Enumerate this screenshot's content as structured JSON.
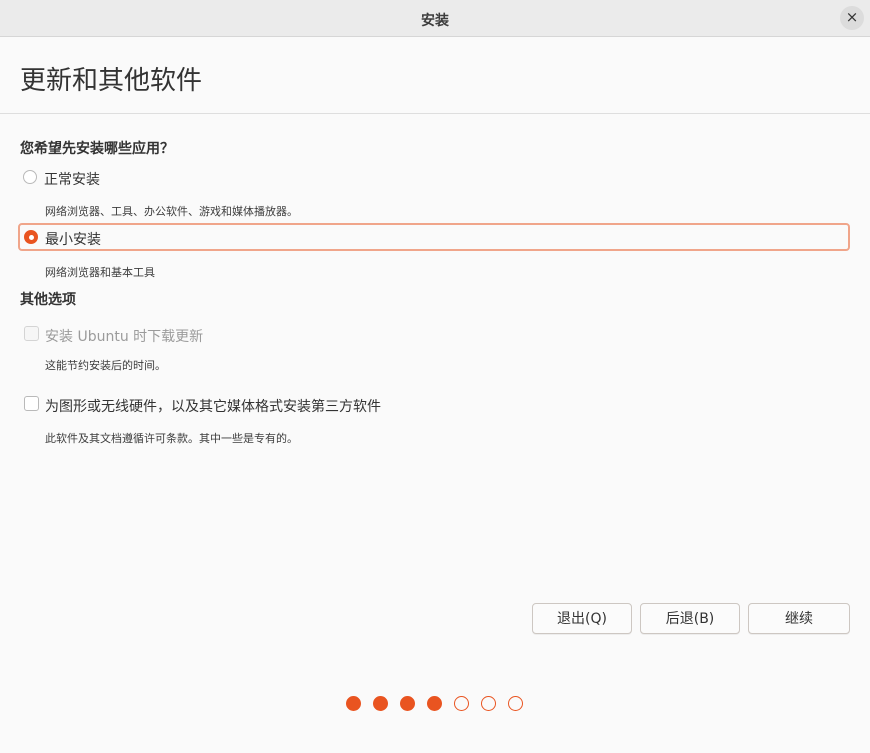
{
  "window": {
    "title": "安装",
    "close_glyph": "×"
  },
  "page_title": "更新和其他软件",
  "question": "您希望先安装哪些应用？",
  "install_options": [
    {
      "label": "正常安装",
      "description": "网络浏览器、工具、办公软件、游戏和媒体播放器。",
      "selected": false
    },
    {
      "label": "最小安装",
      "description": "网络浏览器和基本工具",
      "selected": true
    }
  ],
  "other_options": {
    "heading": "其他选项",
    "items": [
      {
        "label": "安装 Ubuntu 时下载更新",
        "description": "这能节约安装后的时间。",
        "checked": false,
        "disabled": true
      },
      {
        "label": "为图形或无线硬件，以及其它媒体格式安装第三方软件",
        "description": "此软件及其文档遵循许可条款。其中一些是专有的。",
        "checked": false,
        "disabled": false
      }
    ]
  },
  "buttons": {
    "quit": "退出(Q)",
    "back": "后退(B)",
    "continue": "继续"
  },
  "progress": {
    "total_steps": 7,
    "completed_steps": 4
  },
  "colors": {
    "accent": "#e95420"
  }
}
